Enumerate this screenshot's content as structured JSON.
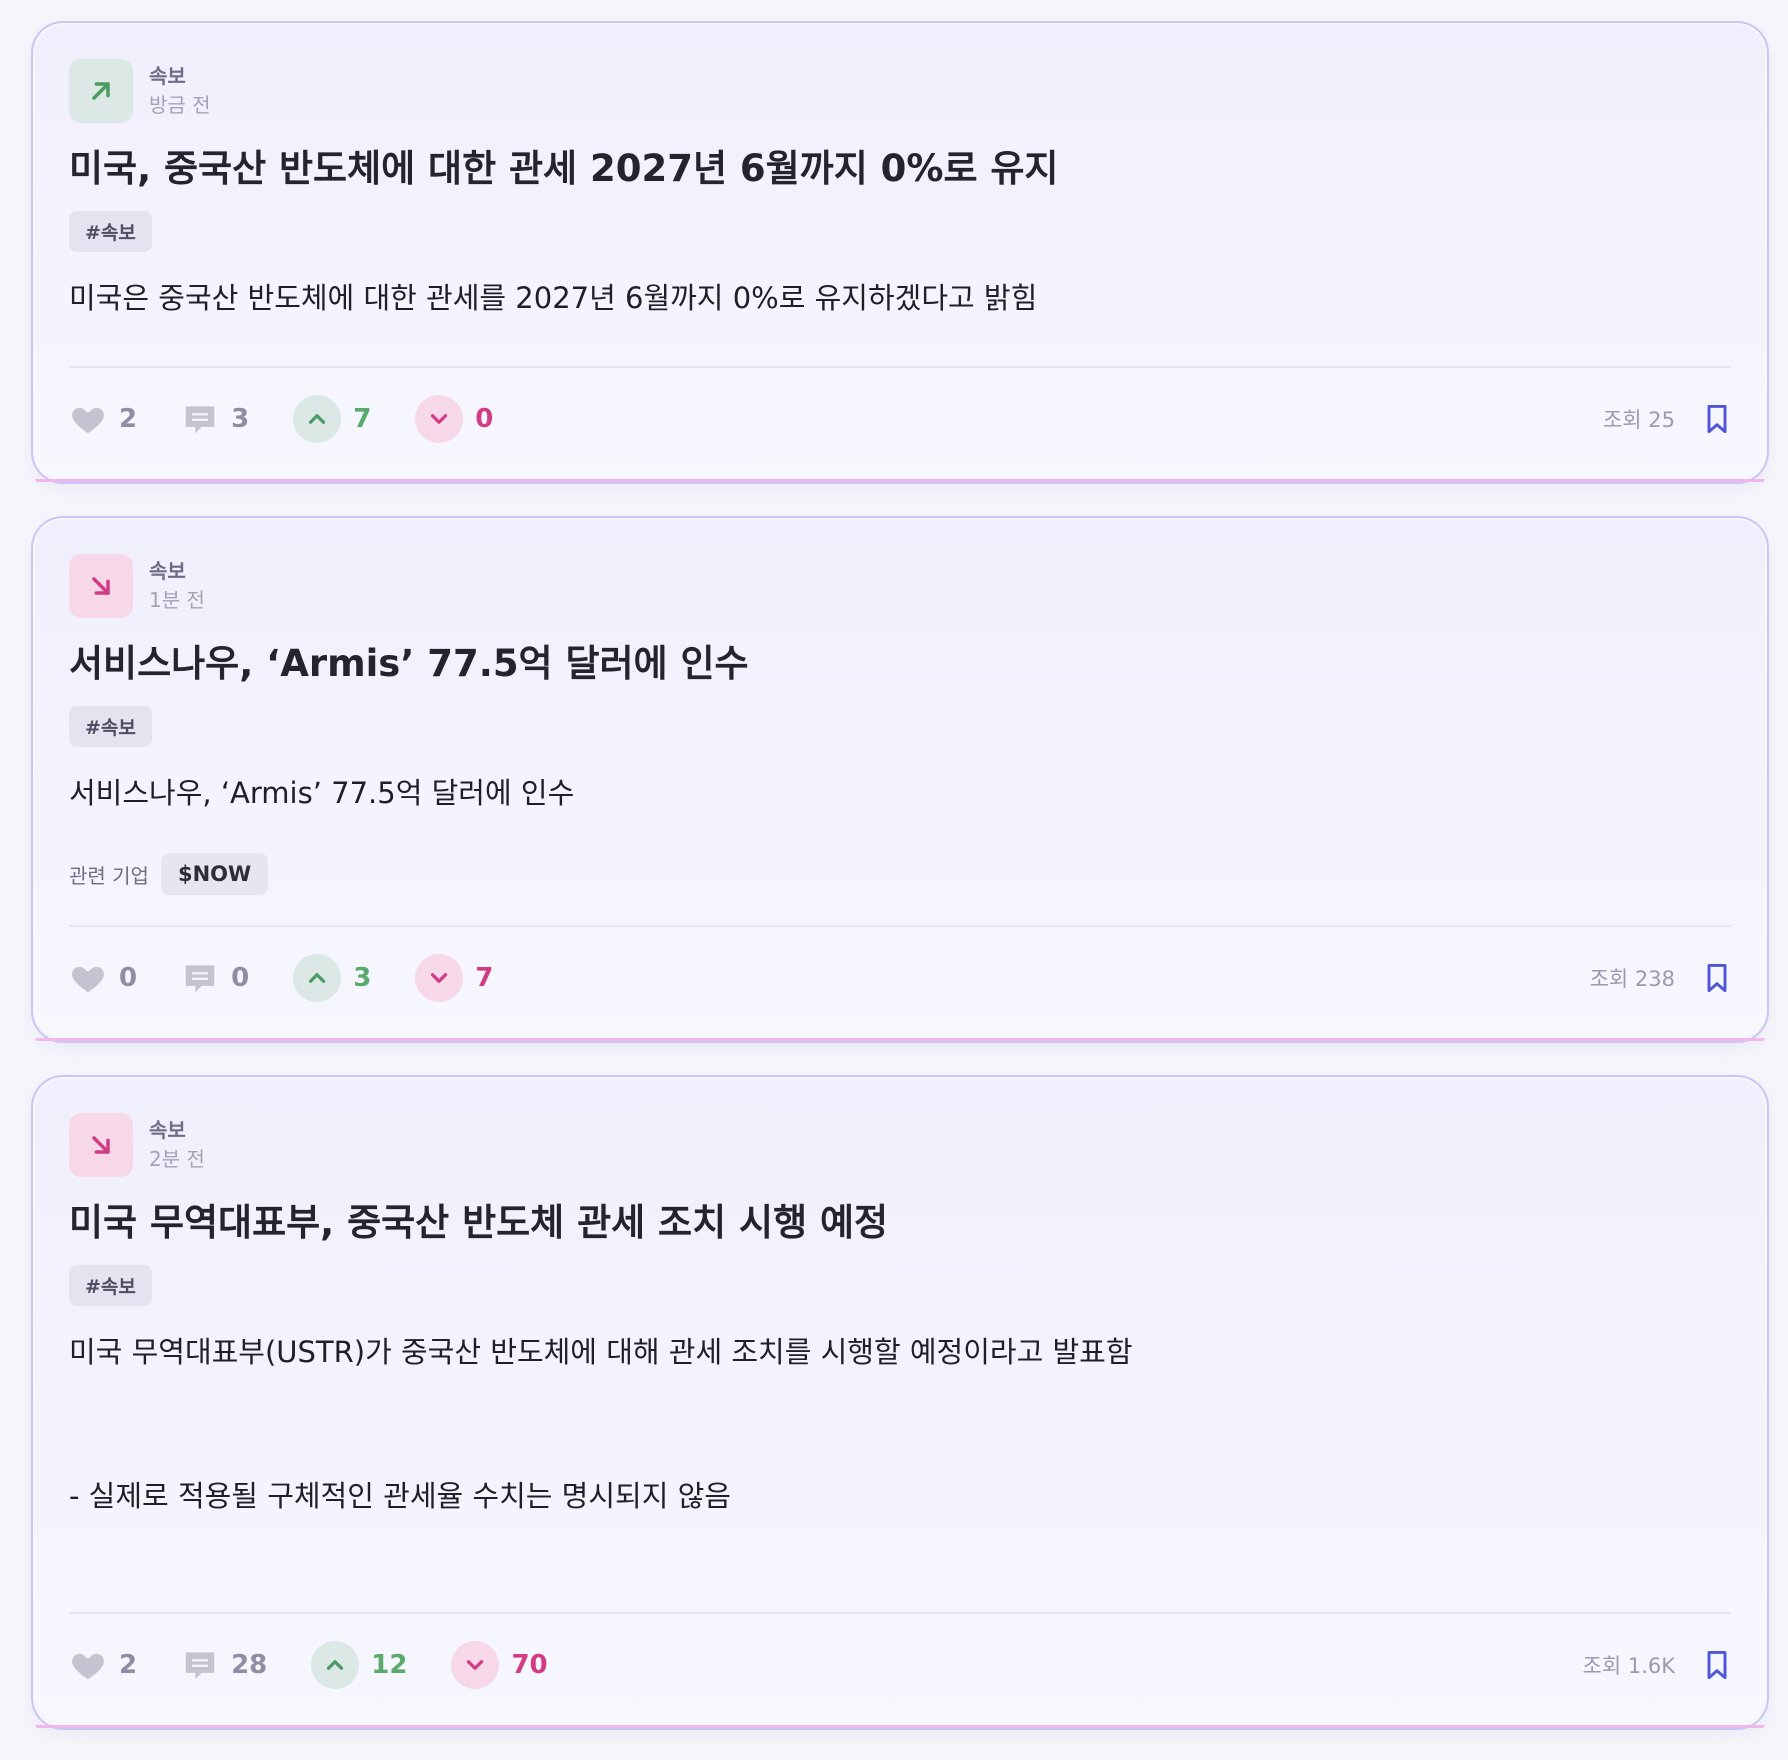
{
  "posts": [
    {
      "category": "속보",
      "time": "방금 전",
      "trend": "up",
      "title": "미국, 중국산 반도체에 대한 관세 2027년 6월까지 0%로 유지",
      "tag": "#속보",
      "body": [
        "미국은 중국산 반도체에 대한 관세를 2027년 6월까지 0%로 유지하겠다고 밝힘"
      ],
      "likes": "2",
      "comments": "3",
      "upvotes": "7",
      "downvotes": "0",
      "views": "조회 25"
    },
    {
      "category": "속보",
      "time": "1분 전",
      "trend": "down",
      "title": "서비스나우, ‘Armis’ 77.5억 달러에 인수",
      "tag": "#속보",
      "body": [
        "서비스나우, ‘Armis’ 77.5억 달러에 인수"
      ],
      "related_label": "관련 기업",
      "related_ticker": "$NOW",
      "likes": "0",
      "comments": "0",
      "upvotes": "3",
      "downvotes": "7",
      "views": "조회 238"
    },
    {
      "category": "속보",
      "time": "2분 전",
      "trend": "down",
      "title": "미국 무역대표부, 중국산 반도체 관세 조치 시행 예정",
      "tag": "#속보",
      "body": [
        "미국 무역대표부(USTR)가 중국산 반도체에 대해 관세 조치를 시행할 예정이라고 발표함",
        "- 실제로 적용될 구체적인 관세율 수치는 명시되지 않음"
      ],
      "likes": "2",
      "comments": "28",
      "upvotes": "12",
      "downvotes": "70",
      "views": "조회 1.6K"
    }
  ],
  "icons": {
    "trend_up": "arrow-up-right-icon",
    "trend_down": "arrow-down-right-icon",
    "like": "heart-icon",
    "comment": "comment-icon",
    "upvote": "chevron-up-icon",
    "downvote": "chevron-down-icon",
    "bookmark": "bookmark-icon"
  },
  "colors": {
    "up": "#4a9a63",
    "down": "#d23c84",
    "bookmark": "#5156d6"
  }
}
